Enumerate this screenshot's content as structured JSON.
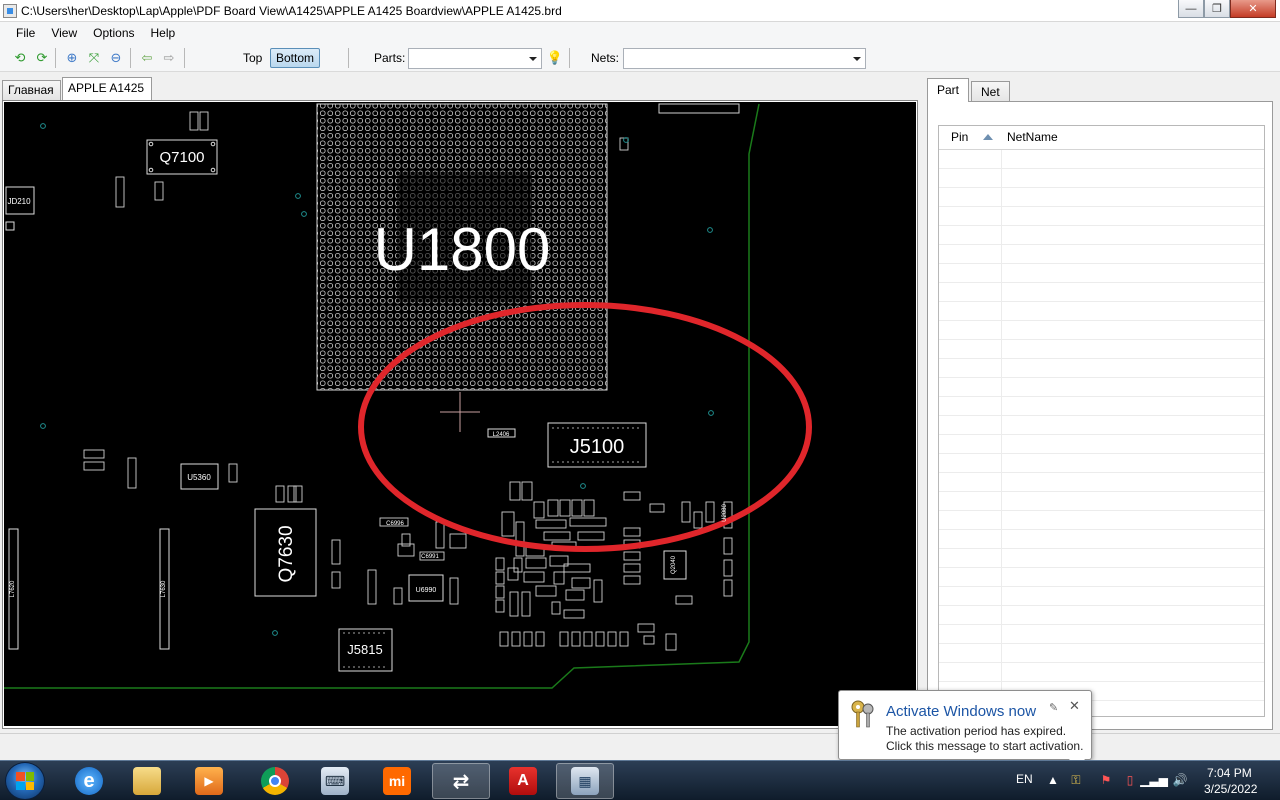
{
  "window": {
    "title": "C:\\Users\\her\\Desktop\\Lap\\Apple\\PDF Board View\\A1425\\APPLE A1425 Boardview\\APPLE A1425.brd",
    "minimize": "—",
    "maximize": "❐",
    "close": "✕"
  },
  "menu": [
    "File",
    "View",
    "Options",
    "Help"
  ],
  "toolbar": {
    "icons": [
      "rotate-left-icon",
      "rotate-right-icon",
      "zoom-in-icon",
      "zoom-fit-icon",
      "zoom-out-icon",
      "arrow-left-icon",
      "arrow-right-icon"
    ],
    "top_label": "Top",
    "bottom_label": "Bottom",
    "parts_label": "Parts:",
    "parts_value": "",
    "nets_label": "Nets:",
    "nets_value": ""
  },
  "tabs": {
    "main": "Главная",
    "board": "APPLE A1425"
  },
  "board": {
    "labels": [
      "Q7100",
      "U1800",
      "J5100",
      "Q7630",
      "J5815",
      "JD210",
      "U5360",
      "U6990",
      "L2406",
      "C6996",
      "C6991",
      "L7620",
      "L7630",
      "U2080",
      "Q2040"
    ]
  },
  "panel": {
    "tabs": [
      "Part",
      "Net"
    ],
    "columns": [
      "Pin",
      "NetName"
    ],
    "rows": []
  },
  "notification": {
    "title": "Activate Windows now",
    "line1": "The activation period has expired.",
    "line2": "Click this message to start activation.",
    "pin": "✎",
    "close": "✕"
  },
  "taskbar": {
    "apps": [
      "internet-explorer",
      "file-explorer",
      "media-player",
      "chrome",
      "keyboard-app",
      "mi-app",
      "shuffle-app",
      "acrobat",
      "boardview-app"
    ],
    "language": "EN",
    "time": "7:04 PM",
    "date": "3/25/2022"
  },
  "colors": {
    "board_bg": "#000000",
    "outline": "#e8e8e8",
    "trace": "#1a7a1a",
    "via": "#1f8f8f",
    "annotation_circle": "#e0262b",
    "active_toggle": "#b9d7ee"
  }
}
